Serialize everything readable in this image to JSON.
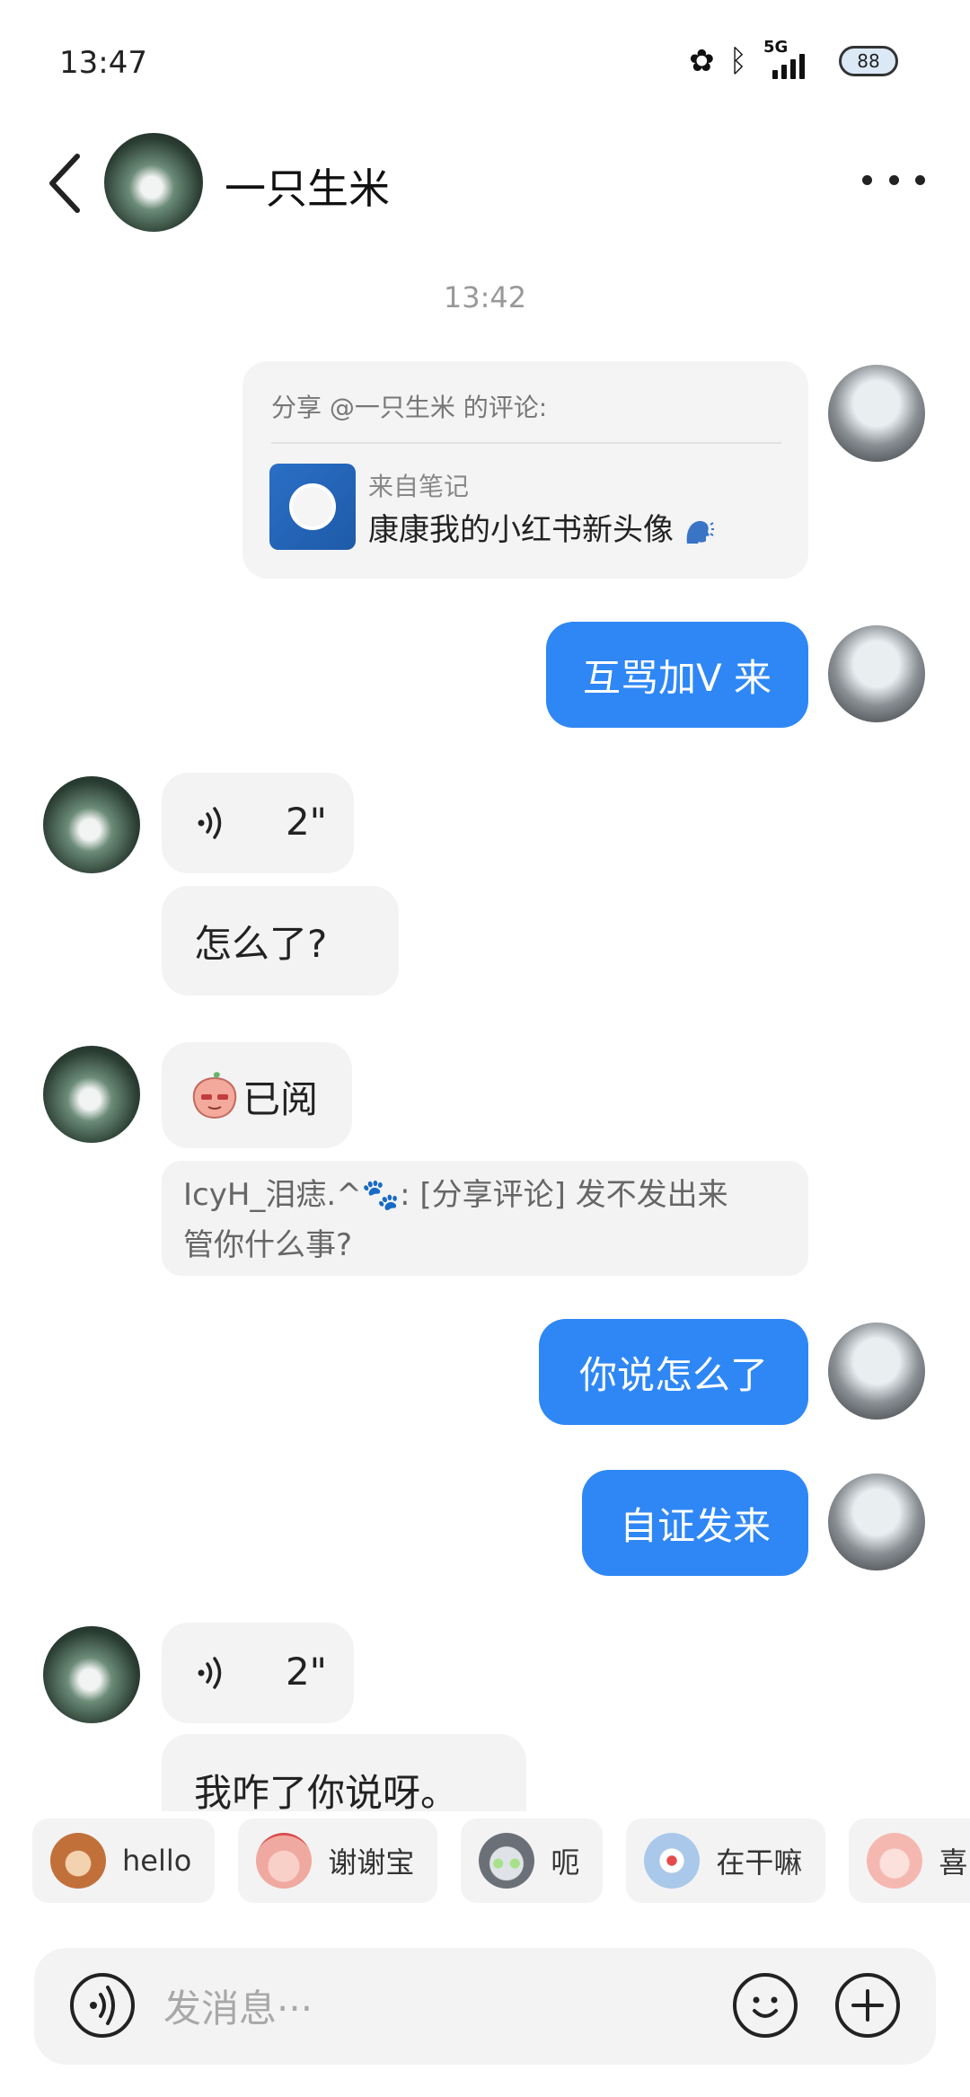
{
  "status": {
    "time": "13:47",
    "network_label": "5G",
    "battery": "88"
  },
  "header": {
    "title": "一只生米"
  },
  "timestamp": "13:42",
  "share_card": {
    "heading": "分享 @一只生米 的评论:",
    "from_label": "来自笔记",
    "note_title": "康康我的小红书新头像"
  },
  "messages": {
    "out_1": "互骂加V 来",
    "voice_1_duration": "2\"",
    "in_1": "怎么了?",
    "read_label": "已阅",
    "quote_line1": "IcyH_泪痣.^",
    "quote_line1_rest": ": [分享评论] 发不发出来",
    "quote_line2": "管你什么事?",
    "out_2": "你说怎么了",
    "out_3": "自证发来",
    "voice_2_duration": "2\"",
    "in_2": "我咋了你说呀。"
  },
  "quick_replies": [
    {
      "label": "hello",
      "icon": "monkey-sticker-icon",
      "color": "#c2703a"
    },
    {
      "label": "谢谢宝",
      "icon": "flower-peach-sticker-icon",
      "color": "#f0a9a0"
    },
    {
      "label": "呃",
      "icon": "cat-sticker-icon",
      "color": "#6b7078"
    },
    {
      "label": "在干嘛",
      "icon": "peek-sticker-icon",
      "color": "#a9c8ea"
    },
    {
      "label": "喜",
      "icon": "pig-sticker-icon",
      "color": "#f5b8b0"
    }
  ],
  "input": {
    "placeholder": "发消息···"
  },
  "colors": {
    "outgoing_bubble": "#2e87f5",
    "incoming_bubble": "#f3f3f4"
  }
}
